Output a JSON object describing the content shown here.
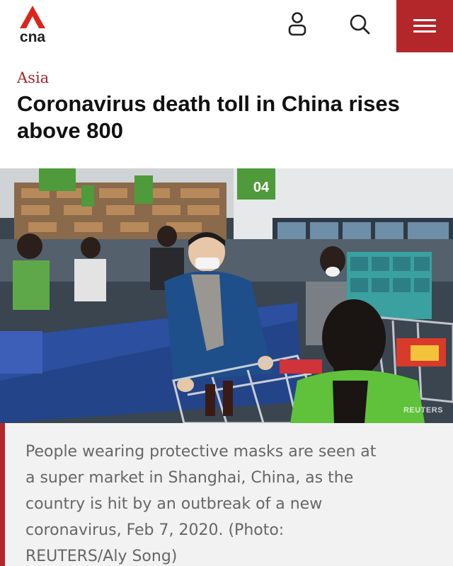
{
  "brand": {
    "name": "cna",
    "accent": "#b3262a"
  },
  "header": {
    "user_icon": "user-icon",
    "search_icon": "search-icon",
    "menu_icon": "hamburger-menu-icon"
  },
  "article": {
    "section": "Asia",
    "headline": "Coronavirus death toll in China rises above 800",
    "photo": {
      "watermark": "REUTERS",
      "aisle_sign": "04"
    },
    "caption": "People wearing protective masks are seen at a super market in Shanghai, China, as the country is hit by an outbreak of a new coronavirus, Feb 7, 2020. (Photo: REUTERS/Aly Song)"
  }
}
